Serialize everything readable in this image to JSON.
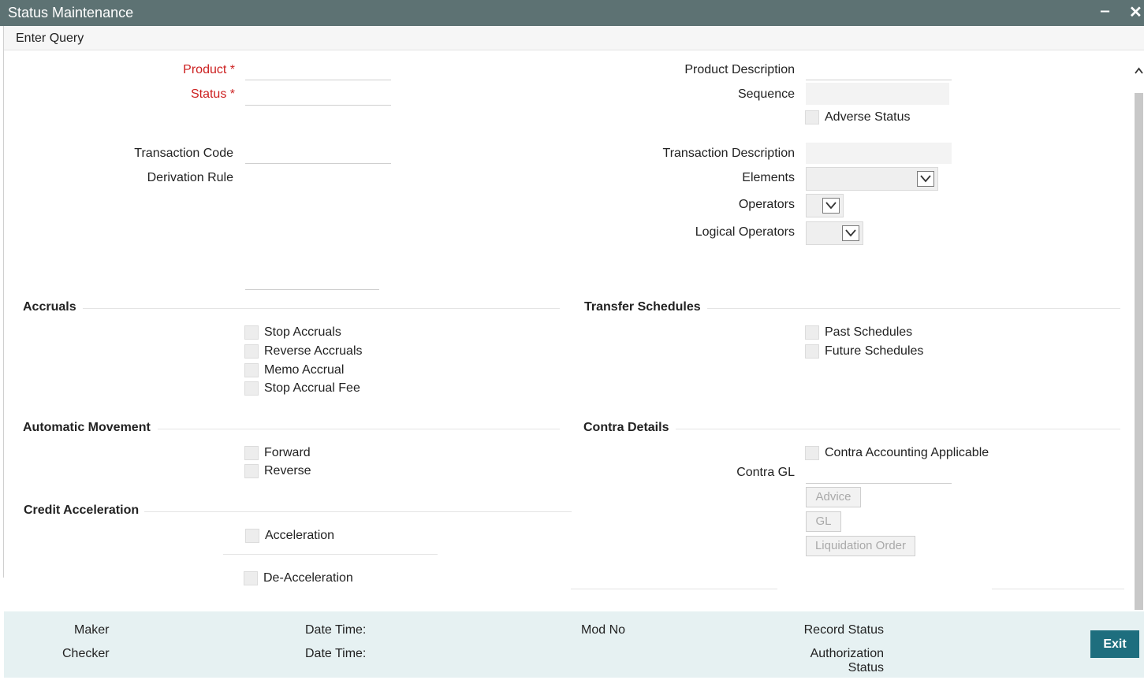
{
  "window": {
    "title": "Status Maintenance",
    "minimize": "‒",
    "close": "✕"
  },
  "menu": {
    "enter_query": "Enter Query"
  },
  "form": {
    "product_label": "Product",
    "status_label": "Status",
    "required_mark": "*",
    "product_description_label": "Product Description",
    "sequence_label": "Sequence",
    "adverse_status_label": "Adverse Status",
    "transaction_code_label": "Transaction Code",
    "transaction_description_label": "Transaction Description",
    "derivation_rule_label": "Derivation Rule",
    "elements_label": "Elements",
    "operators_label": "Operators",
    "logical_operators_label": "Logical Operators"
  },
  "accruals": {
    "title": "Accruals",
    "items": [
      "Stop Accruals",
      "Reverse Accruals",
      "Memo Accrual",
      "Stop Accrual Fee"
    ]
  },
  "transfer_schedules": {
    "title": "Transfer Schedules",
    "items": [
      "Past Schedules",
      "Future Schedules"
    ]
  },
  "automatic_movement": {
    "title": "Automatic Movement",
    "items": [
      "Forward",
      "Reverse"
    ]
  },
  "contra_details": {
    "title": "Contra Details",
    "applicable_label": "Contra Accounting Applicable",
    "gl_label": "Contra GL",
    "buttons": [
      "Advice",
      "GL",
      "Liquidation Order"
    ]
  },
  "credit_acceleration": {
    "title": "Credit Acceleration",
    "acceleration_label": "Acceleration",
    "deacceleration_label": "De-Acceleration"
  },
  "footer": {
    "maker": "Maker",
    "checker": "Checker",
    "date_time_1": "Date Time:",
    "date_time_2": "Date Time:",
    "mod_no": "Mod No",
    "record_status": "Record Status",
    "authorization_status_1": "Authorization",
    "authorization_status_2": "Status",
    "exit": "Exit"
  }
}
